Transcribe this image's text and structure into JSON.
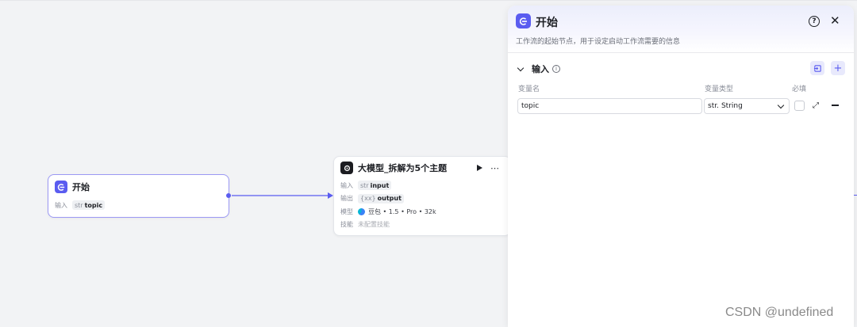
{
  "start_node": {
    "title": "开始",
    "input_label": "输入",
    "input_type": "str",
    "input_name": "topic"
  },
  "llm_node": {
    "title": "大模型_拆解为5个主题",
    "input_label": "输入",
    "input_type": "str",
    "input_name": "input",
    "output_label": "输出",
    "output_type": "{xx}",
    "output_name": "output",
    "model_label": "模型",
    "model_value": "豆包 • 1.5 • Pro • 32k",
    "skill_label": "技能",
    "skill_value": "未配置技能"
  },
  "panel": {
    "title": "开始",
    "description": "工作流的起始节点，用于设定启动工作流需要的信息",
    "section_title": "输入",
    "columns": {
      "name": "变量名",
      "type": "变量类型",
      "required": "必填"
    },
    "row": {
      "name": "topic",
      "type_prefix": "str.",
      "type": "String",
      "required": false
    }
  },
  "watermark": "CSDN @undefined",
  "colors": {
    "accent": "#5a5cf0",
    "canvas": "#f2f3f5"
  }
}
